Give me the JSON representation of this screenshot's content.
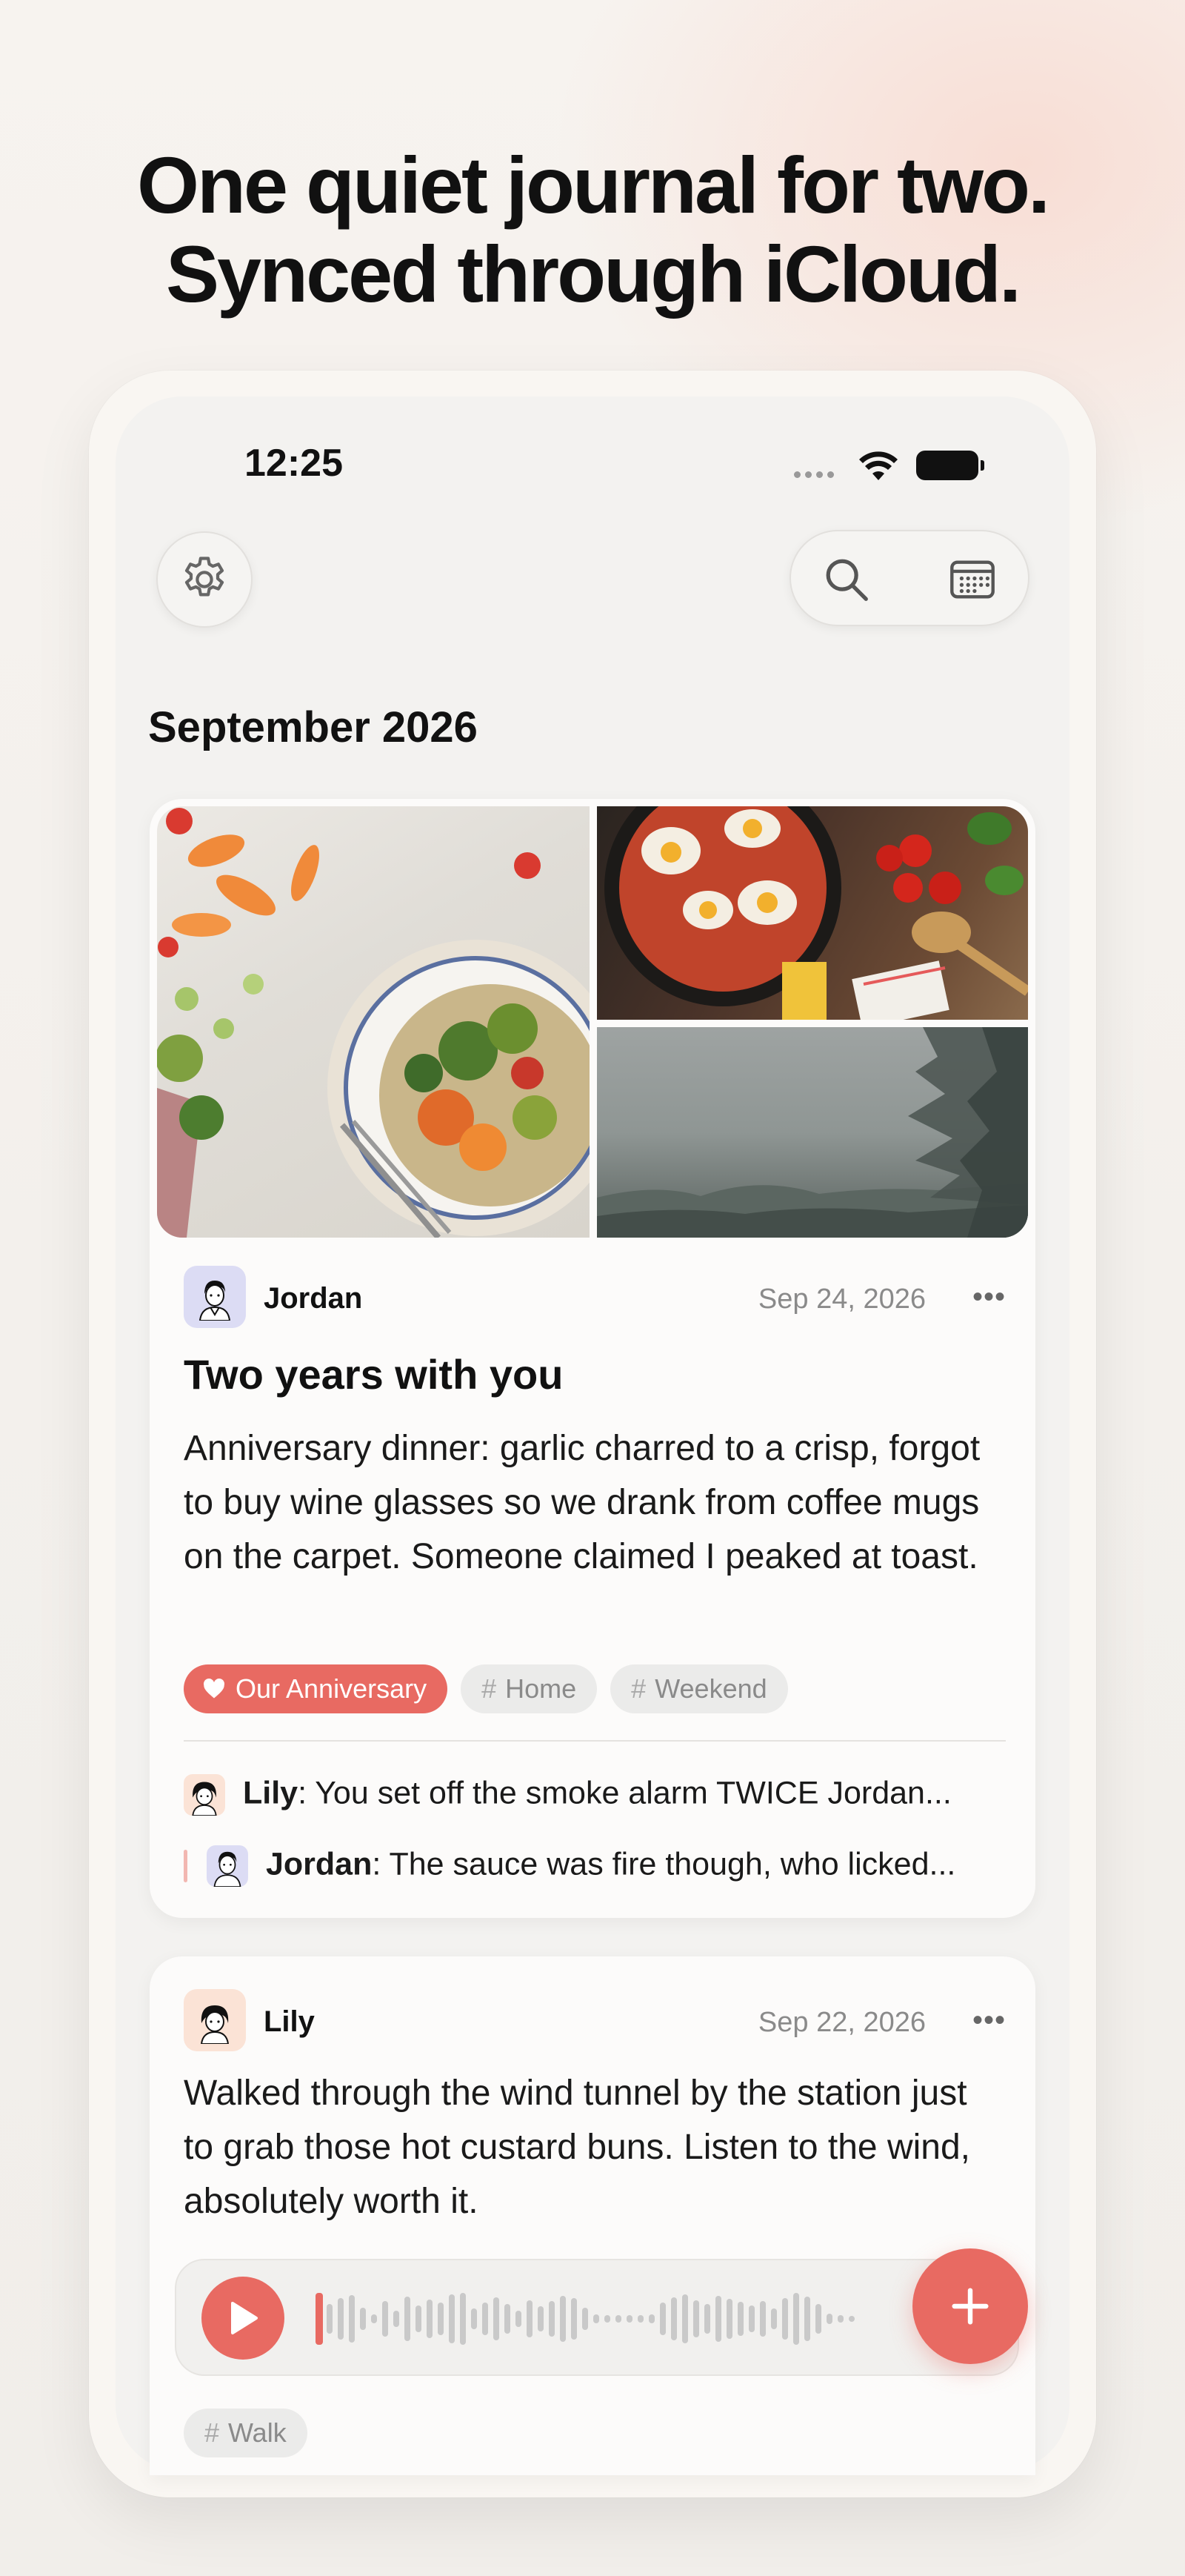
{
  "headline": {
    "line1": "One quiet journal for two.",
    "line2": "Synced through iCloud."
  },
  "status_bar": {
    "time": "12:25"
  },
  "toolbar": {
    "settings_icon": "gear-icon",
    "search_icon": "search-icon",
    "calendar_icon": "calendar-icon"
  },
  "month_title": "September 2026",
  "entries": [
    {
      "author": "Jordan",
      "date": "Sep 24, 2026",
      "title": "Two years with you",
      "body": "Anniversary dinner: garlic charred to a crisp, forgot to buy wine glasses so we drank from coffee mugs on the carpet. Someone claimed I peaked at toast.",
      "tags": [
        "Our Anniversary",
        "Home",
        "Weekend"
      ],
      "comments": [
        {
          "author": "Lily",
          "text": ": You set off the smoke alarm TWICE Jordan..."
        },
        {
          "author": "Jordan",
          "text": ": The sauce was fire though, who licked..."
        }
      ]
    },
    {
      "author": "Lily",
      "date": "Sep 22, 2026",
      "body": "Walked through the wind tunnel by the station just to grab those hot custard buns. Listen to the wind, absolutely worth it.",
      "tags": [
        "Walk"
      ]
    }
  ],
  "more_label": "•••",
  "hash_symbol": "#",
  "accent_color": "#e86a62"
}
